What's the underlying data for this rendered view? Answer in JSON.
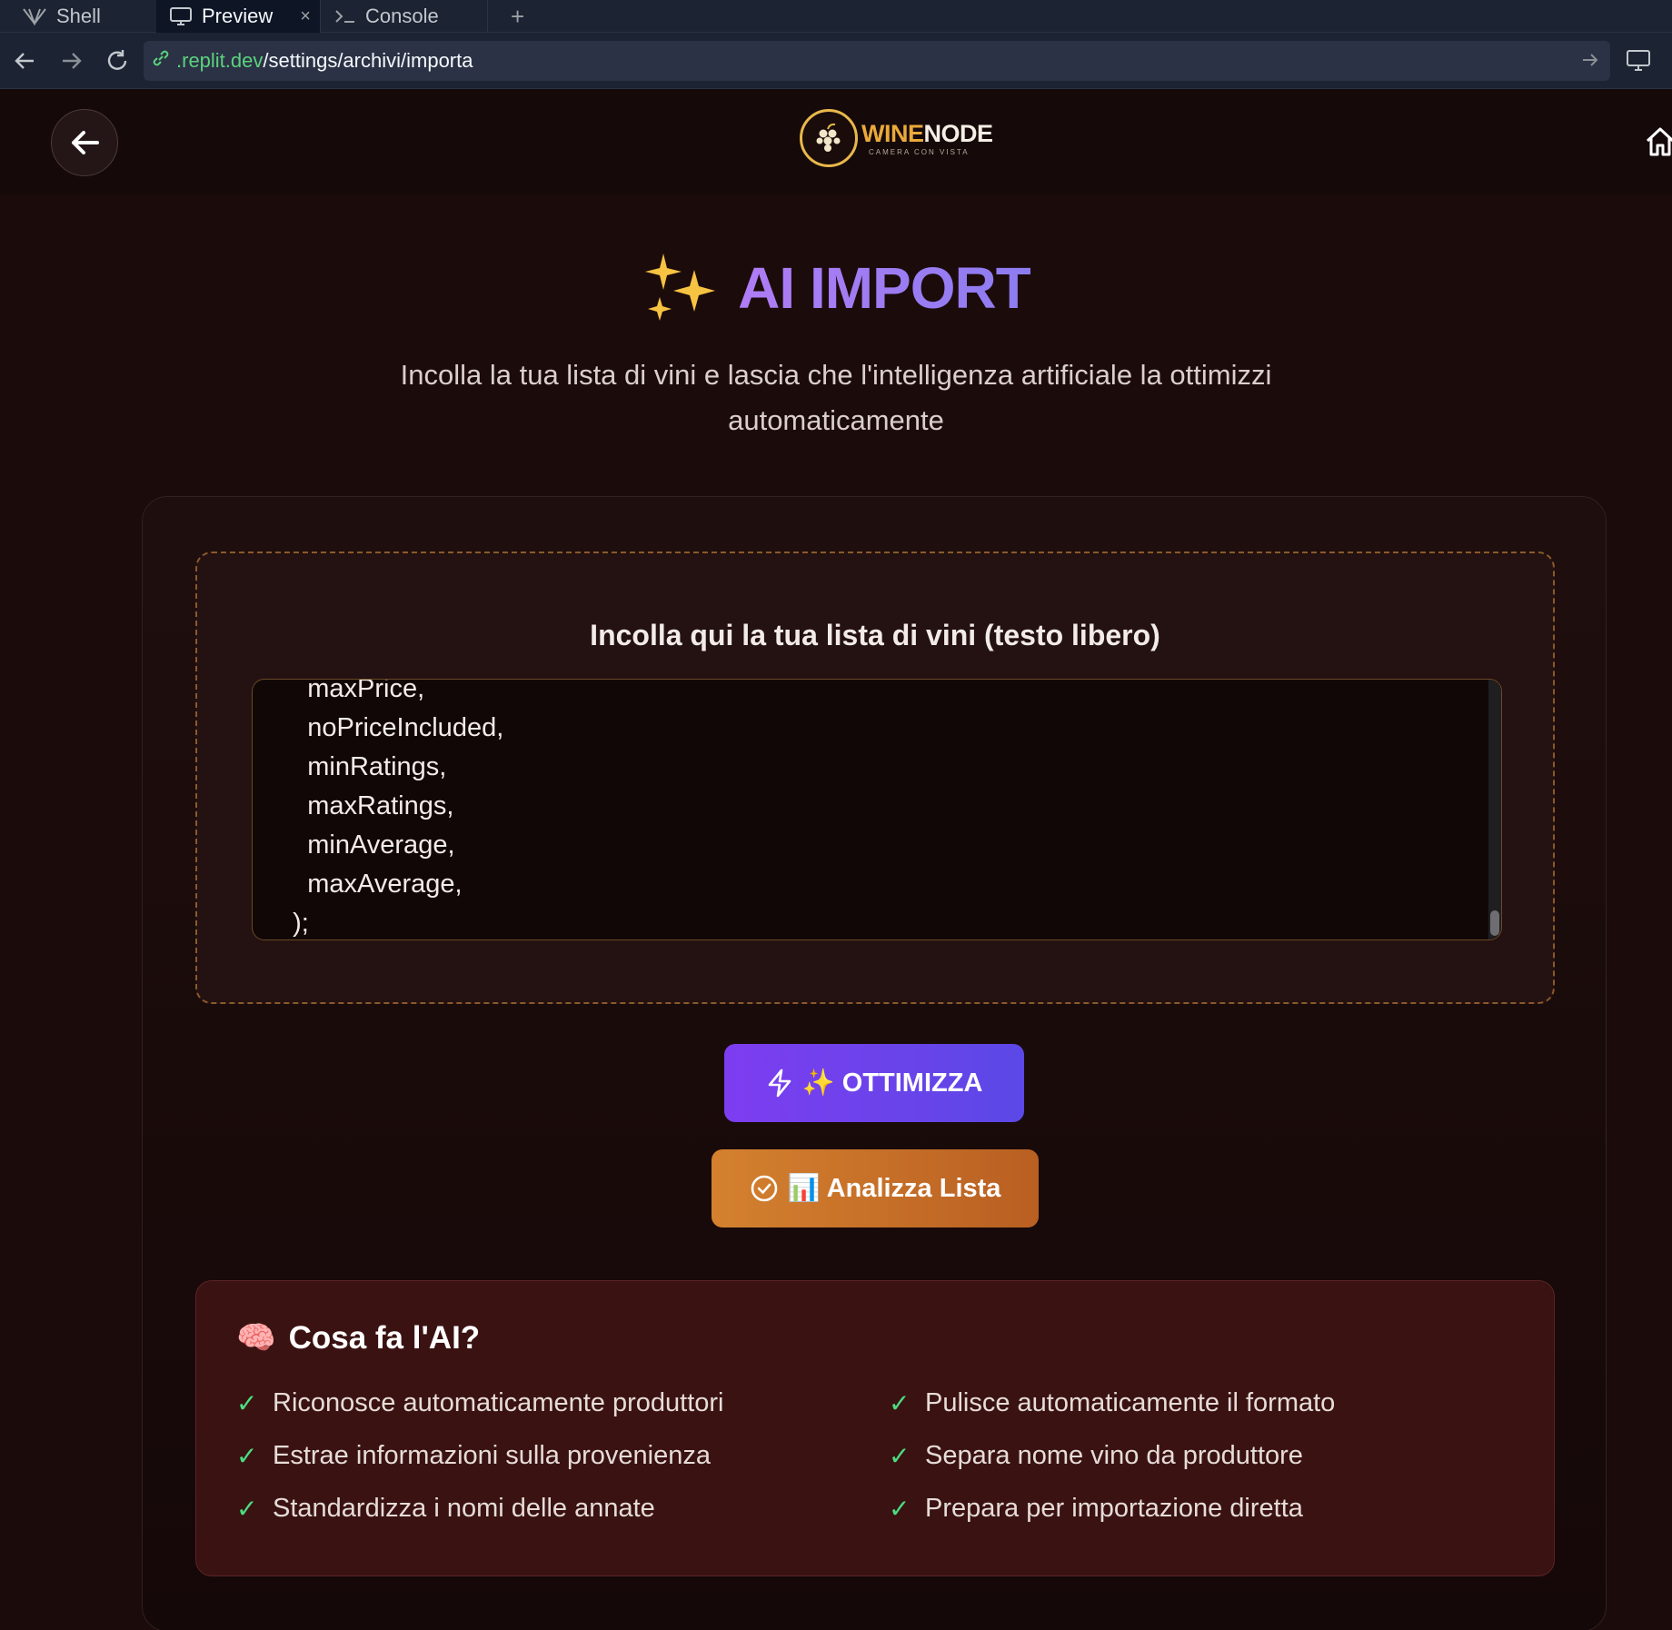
{
  "ide": {
    "tabs": [
      {
        "label": "Shell",
        "icon": "shell-icon"
      },
      {
        "label": "Preview",
        "icon": "monitor-icon",
        "close": "×"
      },
      {
        "label": "Console",
        "icon": "terminal-icon"
      }
    ],
    "add_tab": "+"
  },
  "browser": {
    "url_host": ".replit.dev",
    "url_path": "/settings/archivi/importa"
  },
  "header": {
    "logo_word_1": "WINE",
    "logo_word_2": "NODE",
    "logo_sub": "CAMERA CON VISTA"
  },
  "hero": {
    "title": "AI IMPORT",
    "subtitle": "Incolla la tua lista di vini e lascia che l'intelligenza artificiale la ottimizzi automaticamente"
  },
  "dropzone": {
    "title": "Incolla qui la tua lista di vini (testo libero)",
    "lines": [
      "    maxPrice,",
      "    noPriceIncluded,",
      "    minRatings,",
      "    maxRatings,",
      "    minAverage,",
      "    maxAverage,",
      "  );"
    ]
  },
  "buttons": {
    "optimize": "✨ OTTIMIZZA",
    "analyze": "📊 Analizza Lista"
  },
  "info": {
    "emoji": "🧠",
    "title": "Cosa fa l'AI?",
    "check": "✓",
    "left": [
      "Riconosce automaticamente produttori",
      "Estrae informazioni sulla provenienza",
      "Standardizza i nomi delle annate"
    ],
    "right": [
      "Pulisce automaticamente il formato",
      "Separa nome vino da produttore",
      "Prepara per importazione diretta"
    ]
  },
  "colors": {
    "background": "#1c0b0b",
    "accent_purple": "#8c7cf0",
    "accent_orange": "#d4812f",
    "check_green": "#4ade80"
  }
}
